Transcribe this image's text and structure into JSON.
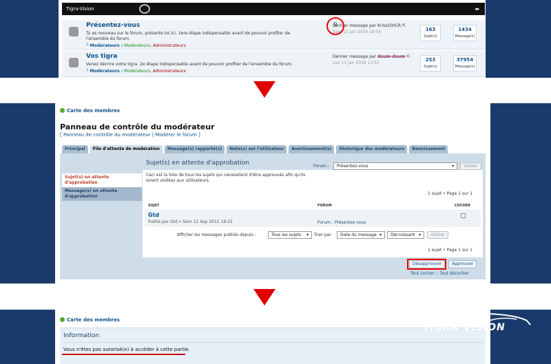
{
  "panel1": {
    "header": "Tigra-Vision",
    "forums": [
      {
        "title": "Présentez-vous",
        "desc": "Tu es nouveau sur le forum, présente toi ici. 1ere étape indispensable avant de pouvoir profiter de l'ensemble du forum.",
        "mods_label": "Modérateurs :",
        "mods": [
          "Modérateurs",
          "Administrateurs"
        ],
        "last_prefix": "Dernier message par",
        "last_user": "Kriss500CR",
        "last_date": "Sam 12 Jan 2016 18:59",
        "topics": "163",
        "topics_label": "Sujet(s)",
        "posts": "1434",
        "posts_label": "Message(s)"
      },
      {
        "title": "Vos tigra",
        "desc": "Venez décrire votre tigra. 2e étape indispensable avant de pouvoir profiter de l'ensemble du forum.",
        "mods_label": "Modérateurs :",
        "mods": [
          "Modérateurs",
          "Administrateurs"
        ],
        "last_prefix": "Dernier message par",
        "last_user": "doum-doum",
        "last_date": "Lun 11 Jan 2016 13:51",
        "topics": "253",
        "topics_label": "Sujet(s)",
        "posts": "37954",
        "posts_label": "Message(s)"
      }
    ]
  },
  "panel2": {
    "members_link": "Carte des membres",
    "title": "Panneau de contrôle du modérateur",
    "crumbs": "[ Panneau de contrôle du modérateur | Modérer le forum ]",
    "tabs": [
      "Principal",
      "File d'attente de modération",
      "Message(s) rapporté(s)",
      "Note(s) sur l'utilisateur",
      "Avertissement(s)",
      "Historique des modérateurs",
      "Bannissement"
    ],
    "left_nav": [
      "Sujet(s) en attente d'approbation",
      "Message(s) en attente d'approbation"
    ],
    "section_title": "Sujet(s) en attente d'approbation",
    "forum_label": "Forum :",
    "forum_select": "Présentez-vous",
    "validate": "Valider",
    "intro": "Ceci est la liste de tous les sujets qui nécessitent d'être approuvés afin qu'ils soient visibles aux utilisateurs.",
    "pagination": "1 sujet • Page 1 sur 1",
    "col_subject": "SUJET",
    "col_forum": "FORUM",
    "col_check": "COCHER",
    "row": {
      "title": "Gtd",
      "meta": "Publié par Gtd » Sam 12 Sep 2015 18:15",
      "forum": "Forum : Présentez-vous"
    },
    "filter_label": "Afficher les messages publiés depuis :",
    "filter_all": "Tous les sujets",
    "sort_label": "Trier par",
    "sort_by": "Date du message",
    "sort_order": "Décroissant",
    "filter_go": "Valider",
    "pagination2": "1 sujet • Page 1 sur 1",
    "disapprove": "Désapprouver",
    "approve": "Approuver",
    "check_all": "Tout cocher",
    "separator": "::",
    "uncheck_all": "Tout décocher"
  },
  "panel3": {
    "members_link": "Carte des membres",
    "info_title": "Information",
    "message": "Vous n'êtes pas autorisé(e) à accéder à cette partie.",
    "logo_text": "TIGRA VISION"
  }
}
